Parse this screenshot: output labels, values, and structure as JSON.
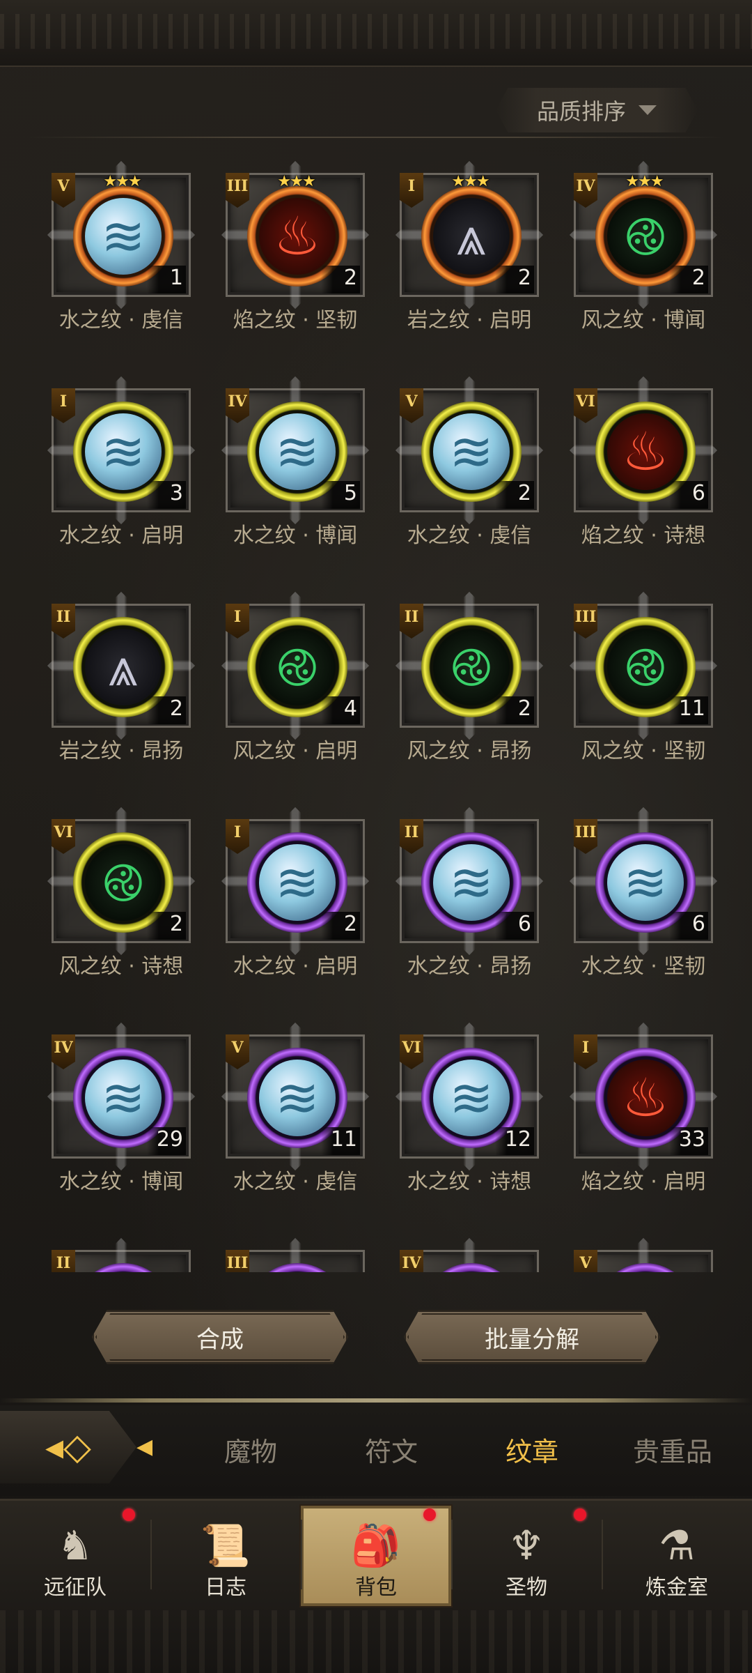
{
  "sort": {
    "label": "品质排序"
  },
  "items": [
    {
      "roman": "V",
      "stars": "★★★",
      "count": "1",
      "name": "水之纹 · 虔信",
      "ring": "orange",
      "element": "water"
    },
    {
      "roman": "III",
      "stars": "★★★",
      "count": "2",
      "name": "焰之纹 · 坚韧",
      "ring": "orange",
      "element": "fire"
    },
    {
      "roman": "I",
      "stars": "★★★",
      "count": "2",
      "name": "岩之纹 · 启明",
      "ring": "orange",
      "element": "rock"
    },
    {
      "roman": "IV",
      "stars": "★★★",
      "count": "2",
      "name": "风之纹 · 博闻",
      "ring": "orange",
      "element": "wind"
    },
    {
      "roman": "I",
      "stars": "",
      "count": "3",
      "name": "水之纹 · 启明",
      "ring": "yellow",
      "element": "water"
    },
    {
      "roman": "IV",
      "stars": "",
      "count": "5",
      "name": "水之纹 · 博闻",
      "ring": "yellow",
      "element": "water"
    },
    {
      "roman": "V",
      "stars": "",
      "count": "2",
      "name": "水之纹 · 虔信",
      "ring": "yellow",
      "element": "water"
    },
    {
      "roman": "VI",
      "stars": "",
      "count": "6",
      "name": "焰之纹 · 诗想",
      "ring": "yellow",
      "element": "fire"
    },
    {
      "roman": "II",
      "stars": "",
      "count": "2",
      "name": "岩之纹 · 昂扬",
      "ring": "yellow",
      "element": "rock"
    },
    {
      "roman": "I",
      "stars": "",
      "count": "4",
      "name": "风之纹 · 启明",
      "ring": "yellow",
      "element": "wind"
    },
    {
      "roman": "II",
      "stars": "",
      "count": "2",
      "name": "风之纹 · 昂扬",
      "ring": "yellow",
      "element": "wind"
    },
    {
      "roman": "III",
      "stars": "",
      "count": "11",
      "name": "风之纹 · 坚韧",
      "ring": "yellow",
      "element": "wind"
    },
    {
      "roman": "VI",
      "stars": "",
      "count": "2",
      "name": "风之纹 · 诗想",
      "ring": "yellow",
      "element": "wind"
    },
    {
      "roman": "I",
      "stars": "",
      "count": "2",
      "name": "水之纹 · 启明",
      "ring": "purple",
      "element": "water"
    },
    {
      "roman": "II",
      "stars": "",
      "count": "6",
      "name": "水之纹 · 昂扬",
      "ring": "purple",
      "element": "water"
    },
    {
      "roman": "III",
      "stars": "",
      "count": "6",
      "name": "水之纹 · 坚韧",
      "ring": "purple",
      "element": "water"
    },
    {
      "roman": "IV",
      "stars": "",
      "count": "29",
      "name": "水之纹 · 博闻",
      "ring": "purple",
      "element": "water"
    },
    {
      "roman": "V",
      "stars": "",
      "count": "11",
      "name": "水之纹 · 虔信",
      "ring": "purple",
      "element": "water"
    },
    {
      "roman": "VI",
      "stars": "",
      "count": "12",
      "name": "水之纹 · 诗想",
      "ring": "purple",
      "element": "water"
    },
    {
      "roman": "I",
      "stars": "",
      "count": "33",
      "name": "焰之纹 · 启明",
      "ring": "purple",
      "element": "fire"
    },
    {
      "roman": "II",
      "stars": "",
      "count": "",
      "name": "",
      "ring": "purple",
      "element": "water"
    },
    {
      "roman": "III",
      "stars": "",
      "count": "",
      "name": "",
      "ring": "purple",
      "element": "water"
    },
    {
      "roman": "IV",
      "stars": "",
      "count": "",
      "name": "",
      "ring": "purple",
      "element": "water"
    },
    {
      "roman": "V",
      "stars": "",
      "count": "",
      "name": "",
      "ring": "purple",
      "element": "water"
    }
  ],
  "element_icons": {
    "water": "≋",
    "fire": "♨",
    "rock": "⩓",
    "wind": "࿋"
  },
  "actions": {
    "combine": "合成",
    "batch_decompose": "批量分解"
  },
  "tabs": [
    {
      "label": "魔物",
      "active": false
    },
    {
      "label": "符文",
      "active": false
    },
    {
      "label": "纹章",
      "active": true
    },
    {
      "label": "贵重品",
      "active": false
    }
  ],
  "nav": [
    {
      "label": "远征队",
      "icon": "viking-helmet-icon",
      "glyph": "♞",
      "badge": true,
      "active": false
    },
    {
      "label": "日志",
      "icon": "scroll-icon",
      "glyph": "📜",
      "badge": false,
      "active": false
    },
    {
      "label": "背包",
      "icon": "backpack-icon",
      "glyph": "🎒",
      "badge": true,
      "active": true
    },
    {
      "label": "圣物",
      "icon": "torch-icon",
      "glyph": "♆",
      "badge": true,
      "active": false
    },
    {
      "label": "炼金室",
      "icon": "alchemy-icon",
      "glyph": "⚗",
      "badge": false,
      "active": false
    }
  ],
  "colors": {
    "accent": "#f2c04a",
    "badge": "#e8162a"
  }
}
